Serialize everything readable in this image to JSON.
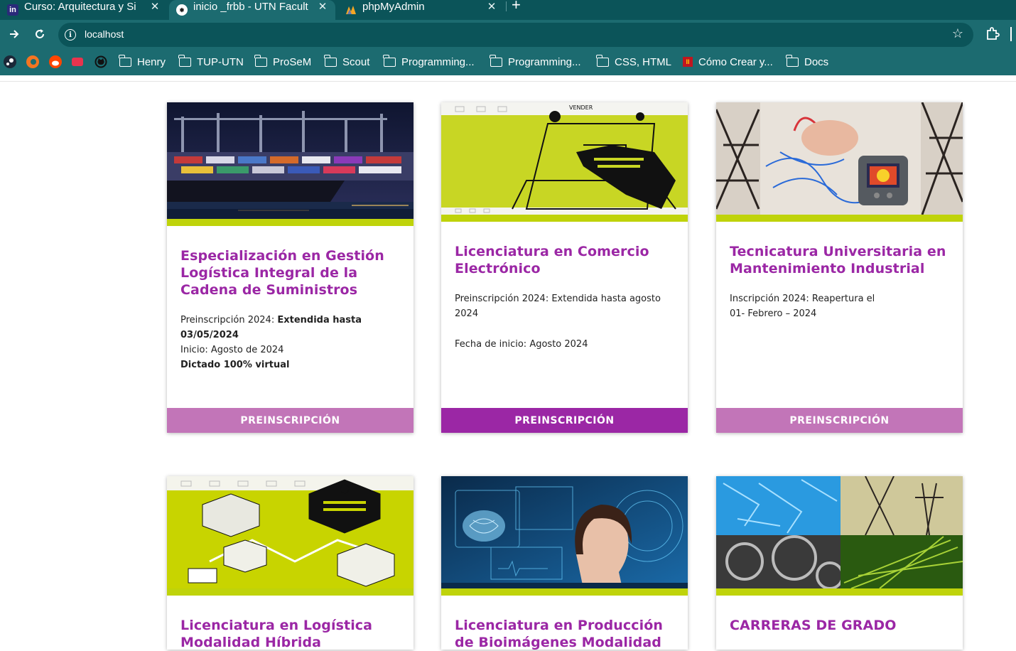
{
  "browser": {
    "tabs": [
      {
        "title": "Curso: Arquitectura y Si",
        "close": "✕",
        "favicon": "in"
      },
      {
        "title": "inicio _frbb - UTN Facult",
        "close": "✕",
        "favicon": "utn"
      },
      {
        "title": "phpMyAdmin",
        "close": "✕",
        "favicon": "pma"
      }
    ],
    "new_tab": "+",
    "url": "localhost",
    "bookmarks": [
      "Henry",
      "TUP-UTN",
      "ProSeM",
      "Scout",
      "Programming...",
      "Programming...",
      "CSS, HTML",
      "Cómo Crear y...",
      "Docs"
    ]
  },
  "cards": [
    {
      "title": "Especialización en Gestión Logística Integral de la Cadena de Suministros",
      "line1_label": "Preinscripción 2024: ",
      "line1_bold": "Extendida  hasta 03/05/2024",
      "line2": "Inicio:  Agosto de 2024",
      "line3_bold": "Dictado 100% virtual",
      "button": "PREINSCRIPCIÓN"
    },
    {
      "title": "Licenciatura en Comercio Electrónico",
      "line1": "Preinscripción 2024: Extendida hasta agosto 2024",
      "line2": "Fecha de inicio: Agosto 2024",
      "button": "PREINSCRIPCIÓN"
    },
    {
      "title": "Tecnicatura Universitaria en Mantenimiento Industrial",
      "line1": "Inscripción 2024: Reapertura el",
      "line2": "01- Febrero – 2024",
      "button": "PREINSCRIPCIÓN"
    },
    {
      "title": "Licenciatura en Logística Modalidad Híbrida"
    },
    {
      "title": "Licenciatura en Producción de Bioimágenes Modalidad"
    },
    {
      "title": "CARRERAS DE GRADO"
    }
  ],
  "colors": {
    "accent": "#9b27a5",
    "button_light": "#c275b8",
    "lime": "#bfd30a",
    "chrome": "#1c6b70"
  }
}
